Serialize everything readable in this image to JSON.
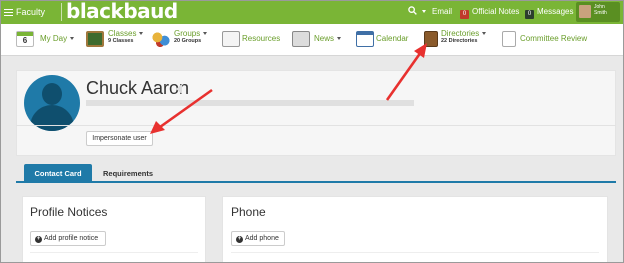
{
  "topbar": {
    "faculty_label": "Faculty",
    "brand": "blackbaud",
    "email_label": "Email",
    "official_notes_label": "Official Notes",
    "official_notes_count": "0",
    "messages_label": "Messages",
    "messages_count": "0",
    "user_first": "John",
    "user_last": "Smith"
  },
  "nav": {
    "my_day": {
      "icon_text": "6",
      "label": "My Day"
    },
    "classes": {
      "label": "Classes",
      "sub": "9 Classes"
    },
    "groups": {
      "label": "Groups",
      "sub": "20 Groups"
    },
    "resources": {
      "label": "Resources"
    },
    "news": {
      "label": "News"
    },
    "calendar": {
      "label": "Calendar"
    },
    "directories": {
      "label": "Directories",
      "sub": "22 Directories"
    },
    "committee_review": {
      "label": "Committee Review"
    }
  },
  "profile": {
    "name": "Chuck Aaron",
    "impersonate_label": "Impersonate user"
  },
  "tabs": [
    {
      "label": "Contact Card",
      "active": true
    },
    {
      "label": "Requirements",
      "active": false
    }
  ],
  "panels": {
    "notices_title": "Profile Notices",
    "notices_button": "Add profile notice",
    "phone_title": "Phone",
    "phone_button": "Add phone"
  },
  "colors": {
    "brand_green": "#7ab536",
    "accent_blue": "#1f7aa8",
    "annotation_red": "#e8312f"
  }
}
